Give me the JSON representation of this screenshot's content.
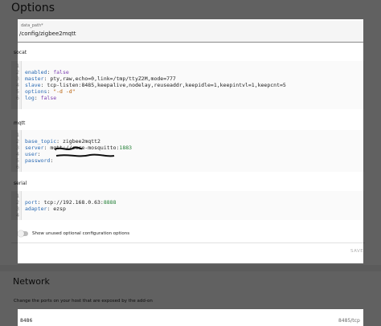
{
  "options": {
    "title": "Options",
    "data_path": {
      "label": "data_path*",
      "value": "/config/zigbee2mqtt"
    }
  },
  "socat": {
    "label": "socat",
    "lines": [
      {
        "n": "1",
        "key": "",
        "sep": "",
        "value": ""
      },
      {
        "n": "2",
        "key": "enabled",
        "sep": ": ",
        "value": "false"
      },
      {
        "n": "3",
        "key": "master",
        "sep": ": ",
        "value": "pty,raw,echo=0,link=/tmp/ttyZ2M,mode=777"
      },
      {
        "n": "4",
        "key": "slave",
        "sep": ": ",
        "value": "tcp-listen:8485,keepalive,nodelay,reuseaddr,keepidle=1,keepintvl=1,keepcnt=5"
      },
      {
        "n": "5",
        "key": "options",
        "sep": ": ",
        "value": "\"-d -d\""
      },
      {
        "n": "6",
        "key": "log",
        "sep": ": ",
        "value": "false"
      }
    ]
  },
  "mqtt": {
    "label": "mqtt",
    "lines": [
      {
        "n": "1",
        "key": "",
        "sep": "",
        "value": ""
      },
      {
        "n": "2",
        "key": "base_topic",
        "sep": ": ",
        "value": "zigbee2mqtt2"
      },
      {
        "n": "3",
        "key": "server",
        "sep": ": ",
        "value": "mqtt://core-mosquitto:",
        "port": "1883"
      },
      {
        "n": "4",
        "key": "user",
        "sep": ": ",
        "value": ""
      },
      {
        "n": "5",
        "key": "password",
        "sep": ": ",
        "value": ""
      },
      {
        "n": "6",
        "key": "",
        "sep": "",
        "value": ""
      }
    ]
  },
  "serial": {
    "label": "serial",
    "lines": [
      {
        "n": "1",
        "key": "",
        "sep": "",
        "value": ""
      },
      {
        "n": "2",
        "key": "port",
        "sep": ": ",
        "value": "tcp://192.168.0.63:",
        "port": "8888"
      },
      {
        "n": "3",
        "key": "adapter",
        "sep": ": ",
        "value": "ezsp"
      },
      {
        "n": "4",
        "key": "",
        "sep": "",
        "value": ""
      }
    ]
  },
  "toggle": {
    "label": "Show unused optional configuration options",
    "state": "off"
  },
  "save": {
    "label": "SAVE"
  },
  "network": {
    "title": "Network",
    "description": "Change the ports on your host that are exposed by the add-on",
    "port_value": "8486",
    "port_container": "8485/tcp"
  },
  "colors": {
    "key": "#2a6ab3",
    "string": "#b55b00",
    "number": "#1e7d32",
    "overlay": "rgba(0,0,0,0.62)"
  }
}
